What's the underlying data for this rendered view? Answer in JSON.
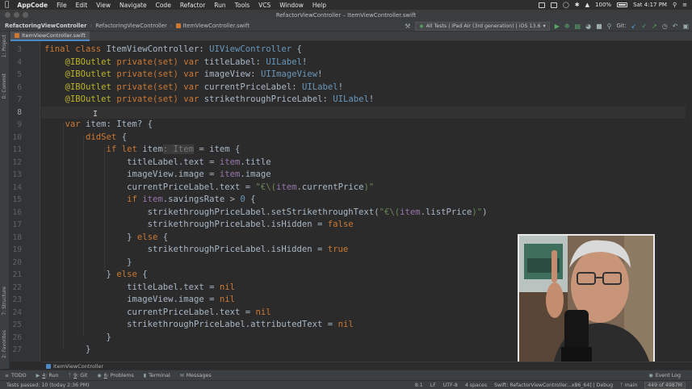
{
  "menubar": {
    "app": "AppCode",
    "items": [
      "File",
      "Edit",
      "View",
      "Navigate",
      "Code",
      "Refactor",
      "Run",
      "Tools",
      "VCS",
      "Window",
      "Help"
    ],
    "battery": "100%",
    "clock": "Sat 4:17 PM"
  },
  "window": {
    "title": "RefactorViewController – ItemViewController.swift"
  },
  "navbar": {
    "project": "RefactoringViewController",
    "folder": "RefactoringViewController",
    "file": "ItemViewController.swift",
    "scheme": "All Tests | iPad Air (3rd generation) | iOS 13.6",
    "git_label": "Git:"
  },
  "tabs": [
    {
      "label": "ItemViewController.swift"
    }
  ],
  "side_tools": {
    "project": "1: Project",
    "commit": "0: Commit",
    "structure": "7: Structure",
    "favorites": "2: Favorites"
  },
  "editor": {
    "line_numbers": [
      "3",
      "4",
      "5",
      "6",
      "7",
      "8",
      "9",
      "10",
      "11",
      "12",
      "13",
      "14",
      "15",
      "16",
      "17",
      "18",
      "19",
      "20",
      "21",
      "22",
      "23",
      "24",
      "25",
      "26",
      "27"
    ],
    "current_line_index": 5,
    "breadcrumb": "ItemViewController"
  },
  "code": {
    "l3": {
      "final": "final",
      "class": "class",
      "name": " ItemViewController: ",
      "super": "UIViewController",
      "brace": " {"
    },
    "iboutlet": "@IBOutlet",
    "private_set": "private(set)",
    "var": "var",
    "l4": {
      "name": " titleLabel: ",
      "type": "UILabel",
      "bang": "!"
    },
    "l5": {
      "name": " imageView: ",
      "type": "UIImageView",
      "bang": "!"
    },
    "l6": {
      "name": " currentPriceLabel: ",
      "type": "UILabel",
      "bang": "!"
    },
    "l7": {
      "name": " strikethroughPriceLabel: ",
      "type": "UILabel",
      "bang": "!"
    },
    "l9": {
      "name": " item: Item? {"
    },
    "l10": {
      "didset": "didSet",
      "brace": " {"
    },
    "l11": {
      "if": "if",
      "let": "let",
      "var": " item",
      "hint": ": Item",
      "rest": " = item {"
    },
    "l12": {
      "lhs": "titleLabel.text = ",
      "item": "item",
      "rest": ".title"
    },
    "l13": {
      "lhs": "imageView.image = ",
      "item": "item",
      "rest": ".image"
    },
    "l14": {
      "lhs": "currentPriceLabel.text = ",
      "str1": "\"€\\(",
      "item": "item",
      "rest": ".currentPrice",
      "str2": ")\""
    },
    "l15": {
      "if": "if",
      "item": " item",
      "rest": ".savingsRate > ",
      "num": "0",
      "brace": " {"
    },
    "l16": {
      "lhs": "strikethroughPriceLabel.setStrikethroughText(",
      "str1": "\"€\\(",
      "item": "item",
      "rest": ".listPrice",
      "str2": ")\"",
      "close": ")"
    },
    "l17": {
      "lhs": "strikethroughPriceLabel.isHidden = ",
      "val": "false"
    },
    "l18": {
      "pre": "} ",
      "else": "else",
      "post": " {"
    },
    "l19": {
      "lhs": "strikethroughPriceLabel.isHidden = ",
      "val": "true"
    },
    "l20": {
      "text": "}"
    },
    "l21": {
      "pre": "} ",
      "else": "else",
      "post": " {"
    },
    "l22": {
      "lhs": "titleLabel.text = ",
      "val": "nil"
    },
    "l23": {
      "lhs": "imageView.image = ",
      "val": "nil"
    },
    "l24": {
      "lhs": "currentPriceLabel.text = ",
      "val": "nil"
    },
    "l25": {
      "lhs": "strikethroughPriceLabel.attributedText = ",
      "val": "nil"
    },
    "l26": {
      "text": "}"
    },
    "l27": {
      "text": "}"
    }
  },
  "bottom_tools": [
    {
      "label": "TODO"
    },
    {
      "num": "4",
      "label": ": Run"
    },
    {
      "num": "9",
      "label": ": Git"
    },
    {
      "num": "6",
      "label": ": Problems"
    },
    {
      "label": "Terminal"
    },
    {
      "label": "Messages"
    }
  ],
  "event_log": "Event Log",
  "status": {
    "message": "Tests passed: 10 (today 2:36 PM)",
    "position": "8:1",
    "line_sep": "LF",
    "encoding": "UTF-8",
    "indent": "4 spaces",
    "context": "Swift: RefactorViewController...x86_64] | Debug",
    "branch": "main",
    "memory": "449 of 4987M"
  },
  "colors": {
    "keyword": "#cc7832",
    "type": "#6897bb",
    "annotation": "#bbb529",
    "property": "#9876aa",
    "string": "#6a8759",
    "default_text": "#a9b7c6",
    "background": "#2b2b2b"
  }
}
